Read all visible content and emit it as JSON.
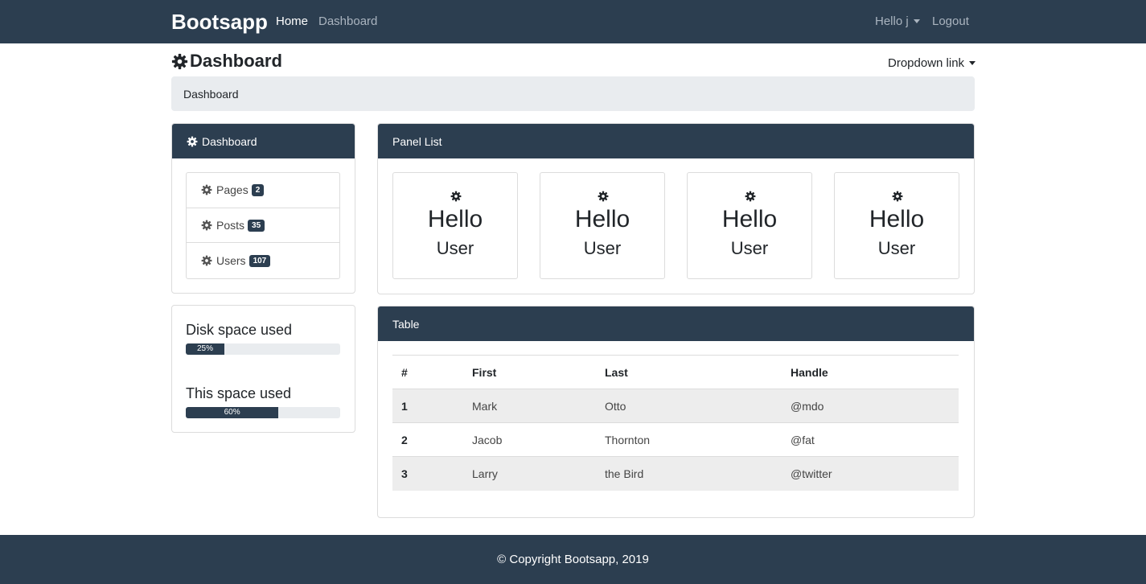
{
  "navbar": {
    "brand": "Bootsapp",
    "links": [
      {
        "label": "Home"
      },
      {
        "label": "Dashboard"
      }
    ],
    "user_menu": "Hello j",
    "logout": "Logout"
  },
  "header": {
    "title": "Dashboard",
    "title_icon": "gear-icon",
    "dropdown": "Dropdown link"
  },
  "breadcrumb": "Dashboard",
  "sidebar": {
    "title": "Dashboard",
    "items": [
      {
        "label": "Pages",
        "count": "2",
        "icon": "gear-icon"
      },
      {
        "label": "Posts",
        "count": "35",
        "icon": "gear-icon"
      },
      {
        "label": "Users",
        "count": "107",
        "icon": "gear-icon"
      }
    ]
  },
  "stats": [
    {
      "title": "Disk space used",
      "value_label": "25%",
      "percent": 25
    },
    {
      "title": "This space used",
      "value_label": "60%",
      "percent": 60
    }
  ],
  "panel_list": {
    "title": "Panel List",
    "items": [
      {
        "line1": "Hello",
        "line2": "User",
        "icon": "gear-icon"
      },
      {
        "line1": "Hello",
        "line2": "User",
        "icon": "gear-icon"
      },
      {
        "line1": "Hello",
        "line2": "User",
        "icon": "gear-icon"
      },
      {
        "line1": "Hello",
        "line2": "User",
        "icon": "gear-icon"
      }
    ]
  },
  "table": {
    "title": "Table",
    "columns": [
      "#",
      "First",
      "Last",
      "Handle"
    ],
    "rows": [
      [
        "1",
        "Mark",
        "Otto",
        "@mdo"
      ],
      [
        "2",
        "Jacob",
        "Thornton",
        "@fat"
      ],
      [
        "3",
        "Larry",
        "the Bird",
        "@twitter"
      ]
    ]
  },
  "footer": "© Copyright Bootsapp, 2019",
  "colors": {
    "primary": "#2c3e50",
    "light": "#e9ecef"
  }
}
